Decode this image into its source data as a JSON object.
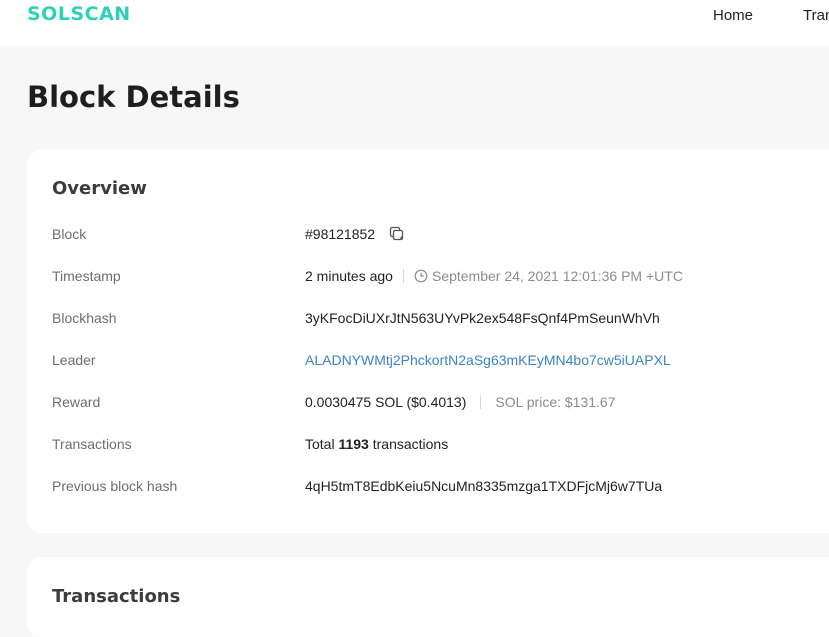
{
  "header": {
    "logo": "SOLSCAN",
    "nav": [
      "Home",
      "Tran"
    ]
  },
  "page": {
    "title": "Block Details"
  },
  "overview": {
    "title": "Overview",
    "block": {
      "label": "Block",
      "value": "#98121852"
    },
    "timestamp": {
      "label": "Timestamp",
      "relative": "2 minutes ago",
      "absolute": "September 24, 2021 12:01:36 PM +UTC"
    },
    "blockhash": {
      "label": "Blockhash",
      "value": "3yKFocDiUXrJtN563UYvPk2ex548FsQnf4PmSeunWhVh"
    },
    "leader": {
      "label": "Leader",
      "value": "ALADNYWMtj2PhckortN2aSg63mKEyMN4bo7cw5iUAPXL"
    },
    "reward": {
      "label": "Reward",
      "value": "0.0030475 SOL ($0.4013)",
      "sol_price": "SOL price: $131.67"
    },
    "transactions": {
      "label": "Transactions",
      "prefix": "Total",
      "count": "1193",
      "suffix": "transactions"
    },
    "previous_blockhash": {
      "label": "Previous block hash",
      "value": "4qH5tmT8EdbKeiu5NcuMn8335mzga1TXDFjcMj6w7TUa"
    }
  },
  "transactions_section": {
    "title": "Transactions"
  },
  "icons": {
    "copy": "copy-icon",
    "clock": "clock-icon"
  },
  "colors": {
    "brand": "#2bd2b8",
    "link": "#3a83c8",
    "background": "#f7f7f7"
  }
}
